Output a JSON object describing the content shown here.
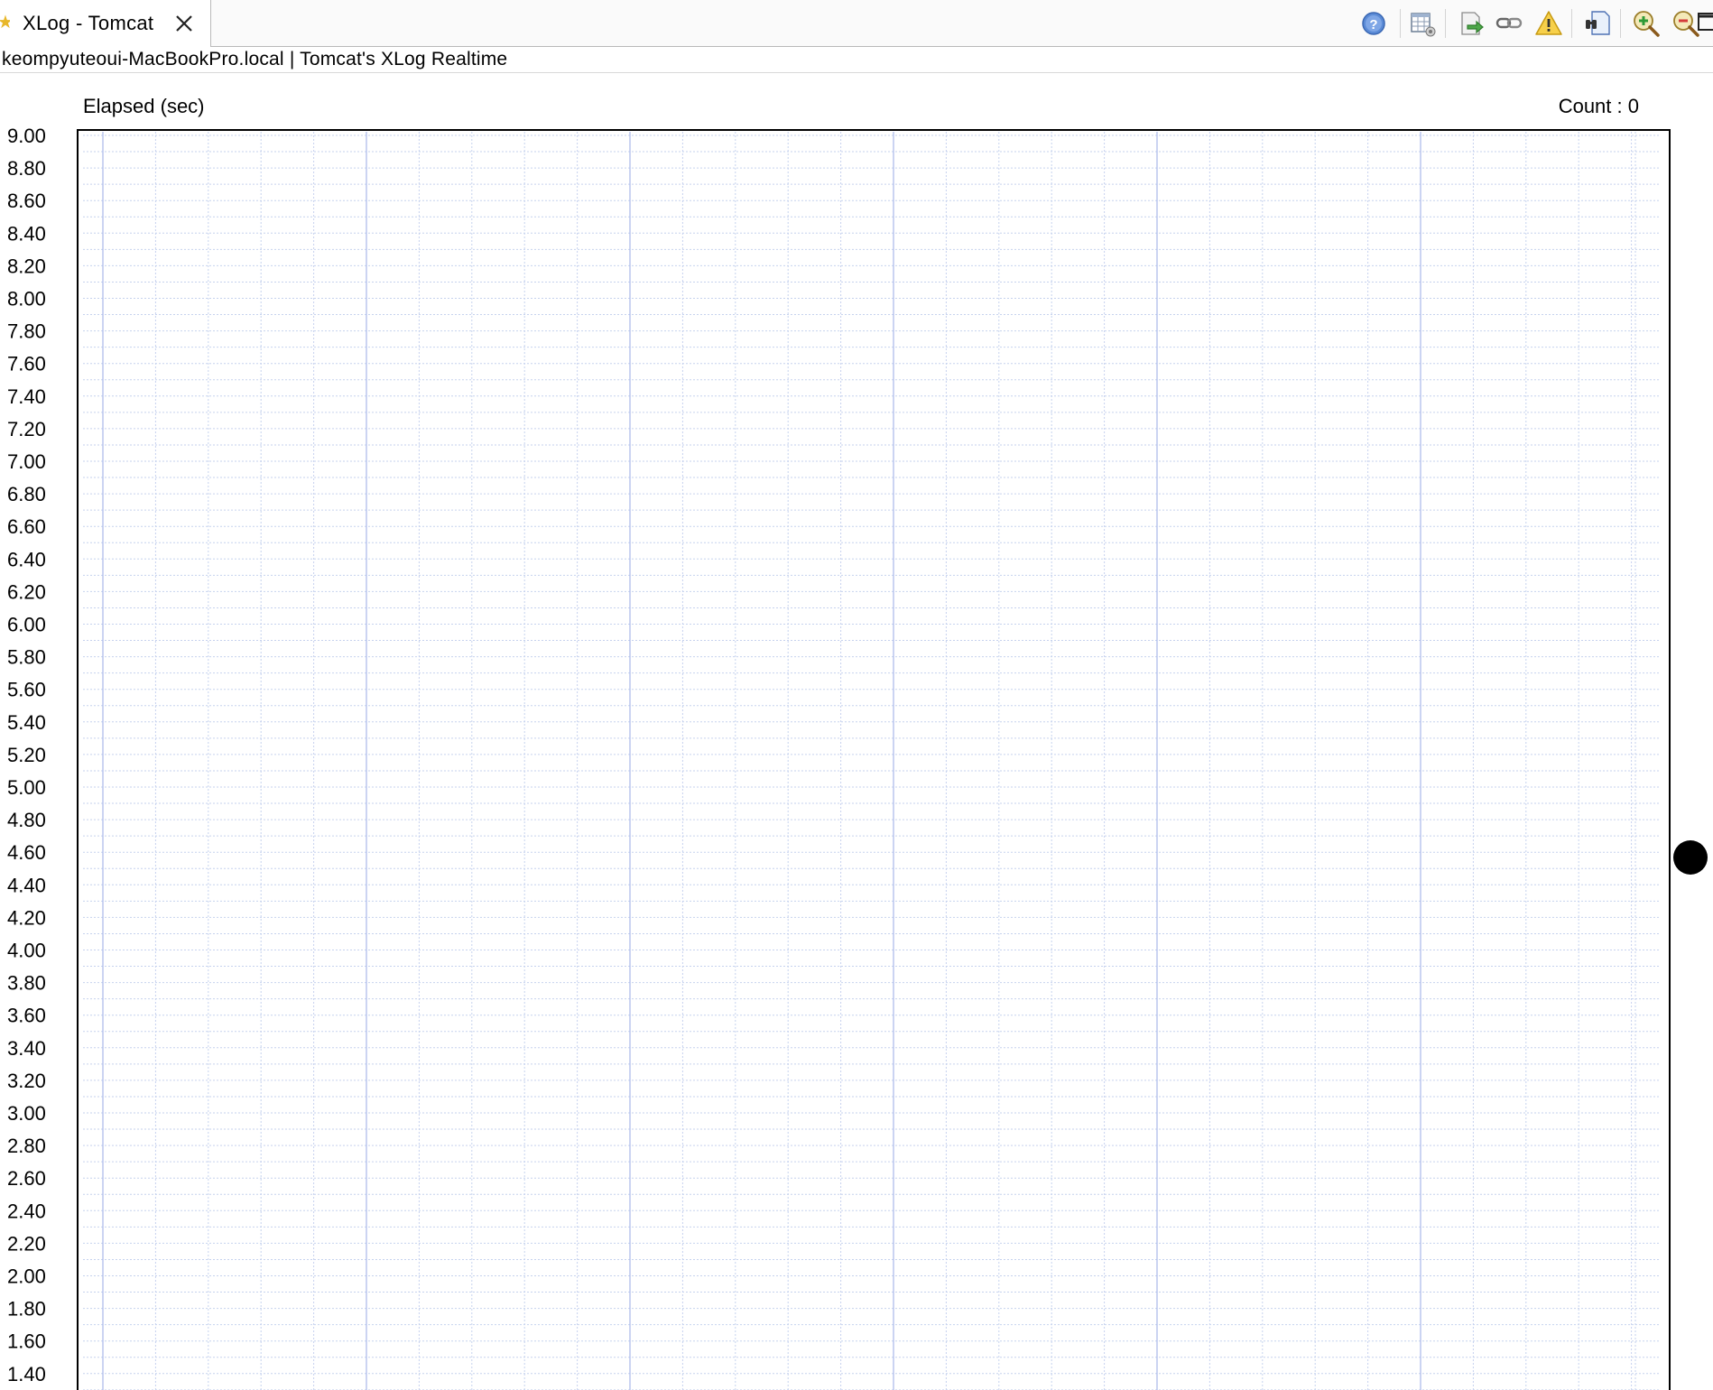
{
  "tab": {
    "title": "XLog - Tomcat",
    "icon": "star-icon",
    "close_icon": "close-icon"
  },
  "toolbar": {
    "buttons": [
      {
        "name": "help-icon"
      },
      {
        "name": "table-view-icon"
      },
      {
        "name": "export-icon"
      },
      {
        "name": "link-icon"
      },
      {
        "name": "warning-icon"
      },
      {
        "name": "find-icon"
      },
      {
        "name": "zoom-in-icon"
      },
      {
        "name": "zoom-out-icon"
      },
      {
        "name": "minimize-icon"
      },
      {
        "name": "maximize-icon"
      }
    ]
  },
  "view": {
    "description": "keompyuteoui-MacBookPro.local | Tomcat's XLog Realtime"
  },
  "chart_data": {
    "type": "scatter",
    "title": "",
    "ylabel": "Elapsed (sec)",
    "count_label": "Count : ",
    "count_value": "0",
    "ylim": [
      1.4,
      9.0
    ],
    "y_ticks": [
      "9.00",
      "8.80",
      "8.60",
      "8.40",
      "8.20",
      "8.00",
      "7.80",
      "7.60",
      "7.40",
      "7.20",
      "7.00",
      "6.80",
      "6.60",
      "6.40",
      "6.20",
      "6.00",
      "5.80",
      "5.60",
      "5.40",
      "5.20",
      "5.00",
      "4.80",
      "4.60",
      "4.40",
      "4.20",
      "4.00",
      "3.80",
      "3.60",
      "3.40",
      "3.20",
      "3.00",
      "2.80",
      "2.60",
      "2.40",
      "2.20",
      "2.00",
      "1.80",
      "1.60",
      "1.40"
    ],
    "points": [],
    "grid": true,
    "colors": {
      "grid_minor": "#c6d2ee",
      "grid_major": "#a9b8ea",
      "border": "#000000"
    }
  }
}
